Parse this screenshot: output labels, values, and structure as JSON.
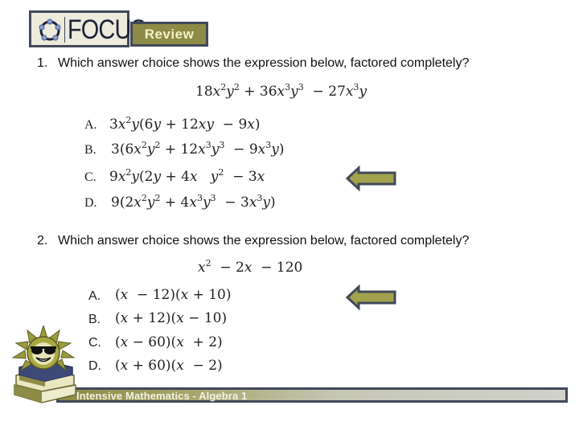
{
  "header": {
    "logo_text": "FOCUS",
    "badge_label": "Review"
  },
  "questions": [
    {
      "number": "1.",
      "prompt": "Which answer choice shows the expression below, factored completely?",
      "expression": "18x²y² + 36x³y³ − 27x³y",
      "choices": [
        {
          "letter": "A.",
          "text": "3x²y(6y + 12xy − 9x)"
        },
        {
          "letter": "B.",
          "text": "3(6x²y² + 12x³y³ − 9x³y)"
        },
        {
          "letter": "C.",
          "text": "9x²y(2y + 4x  y² − 3x"
        },
        {
          "letter": "D.",
          "text": "9(2x²y² + 4x³y³ − 3x³y)"
        }
      ],
      "indicated_choice": "C."
    },
    {
      "number": "2.",
      "prompt": "Which answer choice shows the expression below, factored completely?",
      "expression": "x² − 2x − 120",
      "choices": [
        {
          "letter": "A.",
          "text": "(x − 12)(x + 10)"
        },
        {
          "letter": "B.",
          "text": "(x + 12)(x − 10)"
        },
        {
          "letter": "C.",
          "text": "(x − 60)(x + 2)"
        },
        {
          "letter": "D.",
          "text": "(x + 60)(x − 2)"
        }
      ],
      "indicated_choice": "A."
    }
  ],
  "footer": {
    "course_title": "Intensive Mathematics - Algebra 1"
  },
  "icons": {
    "logo": "focus-ring-logo-icon",
    "arrow": "left-arrow-icon",
    "mascot": "sun-with-sunglasses-on-books-icon"
  },
  "colors": {
    "olive": "#8d8b45",
    "navy_border": "#414a5a",
    "badge_text": "#f4f1c9",
    "logo_bg": "#ecebdc"
  }
}
